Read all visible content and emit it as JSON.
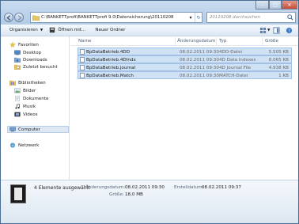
{
  "address": {
    "path": "C:\\BANKETTprofi\\BANKETTprofi 9.0\\Datensicherung\\20110208"
  },
  "search": {
    "placeholder": "20110208 durchsuchen"
  },
  "toolbar": {
    "organize_label": "Organisieren",
    "open_with_label": "Öffnen mit...",
    "new_folder_label": "Neuer Ordner"
  },
  "sidebar": {
    "favorites": {
      "heading": "Favoriten",
      "items": [
        "Desktop",
        "Downloads",
        "Zuletzt besucht"
      ]
    },
    "libraries": {
      "heading": "Bibliotheken",
      "items": [
        "Bilder",
        "Dokumente",
        "Musik",
        "Videos"
      ]
    },
    "computer": "Computer",
    "network": "Netzwerk"
  },
  "columns": {
    "name": "Name",
    "modified": "Änderungsdatum",
    "type": "Typ",
    "size": "Größe"
  },
  "files": [
    {
      "name": "BpDataBetrieb.4DD",
      "modified": "08.02.2011 09:30",
      "type": "4DD-Datei",
      "size": "5.505 KB"
    },
    {
      "name": "BpDataBetrieb.4DIndx",
      "modified": "08.02.2011 09:30",
      "type": "4D Data Indexes",
      "size": "8.065 KB"
    },
    {
      "name": "BpDataBetrieb.journal",
      "modified": "08.02.2011 09:30",
      "type": "4D Journal File",
      "size": "4.938 KB"
    },
    {
      "name": "BpDataBetrieb.Match",
      "modified": "08.02.2011 09:30",
      "type": "MATCH-Datei",
      "size": "1 KB"
    }
  ],
  "details": {
    "count": "4 Elemente ausgewählt",
    "modified_label": "Änderungsdatum:",
    "modified_value": "08.02.2011 09:30",
    "created_label": "Erstelldatum:",
    "created_value": "08.02.2011 09:37",
    "size_label": "Größe:",
    "size_value": "18,0 MB"
  },
  "colors": {
    "selection": "#cfe1f4",
    "selection_border": "#a2c1e4",
    "frame": "#b9cfe7",
    "close_button": "#c2442f"
  }
}
